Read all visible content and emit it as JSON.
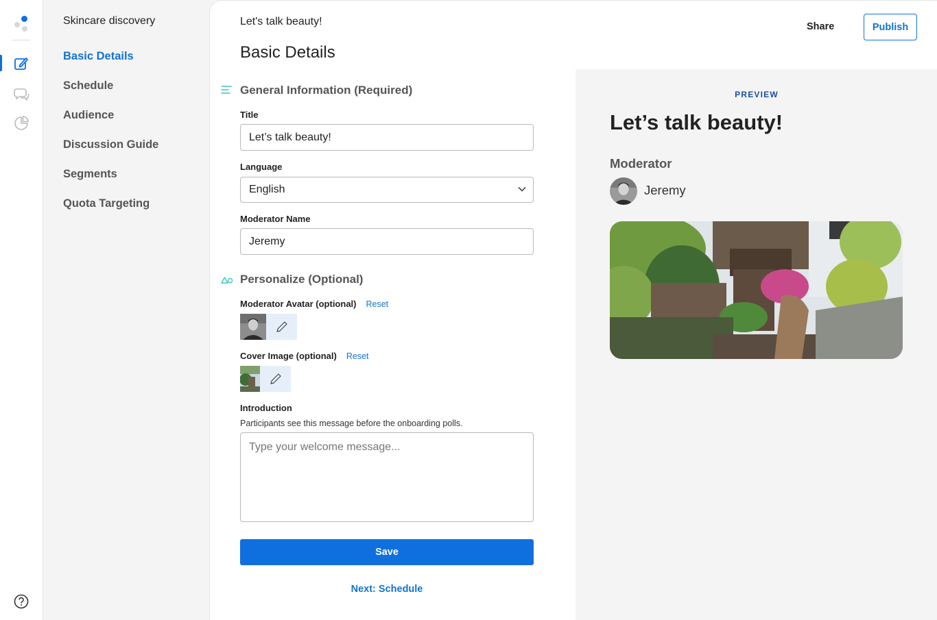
{
  "nav": {
    "project_name": "Skincare discovery",
    "items": [
      {
        "label": "Basic Details",
        "active": true
      },
      {
        "label": "Schedule",
        "active": false
      },
      {
        "label": "Audience",
        "active": false
      },
      {
        "label": "Discussion Guide",
        "active": false
      },
      {
        "label": "Segments",
        "active": false
      },
      {
        "label": "Quota Targeting",
        "active": false
      }
    ]
  },
  "rail": {
    "icons": [
      "app-logo",
      "edit-icon",
      "chat-icon",
      "analytics-icon",
      "help-icon"
    ],
    "accent": "#0f6fde"
  },
  "header": {
    "crumb": "Let's talk beauty!",
    "title": "Basic Details",
    "share_label": "Share",
    "publish_label": "Publish"
  },
  "form": {
    "general_title": "General Information (Required)",
    "title_label": "Title",
    "title_value": "Let’s talk beauty!",
    "language_label": "Language",
    "language_value": "English",
    "moderator_label": "Moderator Name",
    "moderator_value": "Jeremy",
    "personalize_title": "Personalize (Optional)",
    "avatar_label": "Moderator Avatar (optional)",
    "cover_label": "Cover Image (optional)",
    "reset_label": "Reset",
    "intro_label": "Introduction",
    "intro_hint": "Participants see this message before the onboarding polls.",
    "intro_placeholder": "Type your welcome message...",
    "save_label": "Save",
    "next_label": "Next: Schedule"
  },
  "preview": {
    "label": "PREVIEW",
    "title": "Let’s talk beauty!",
    "moderator_heading": "Moderator",
    "moderator_name": "Jeremy"
  },
  "colors": {
    "primary": "#0f6fde",
    "link": "#1273d4",
    "teal_icon": "#3cc6c2",
    "preview_bg": "#f4f4f4"
  }
}
